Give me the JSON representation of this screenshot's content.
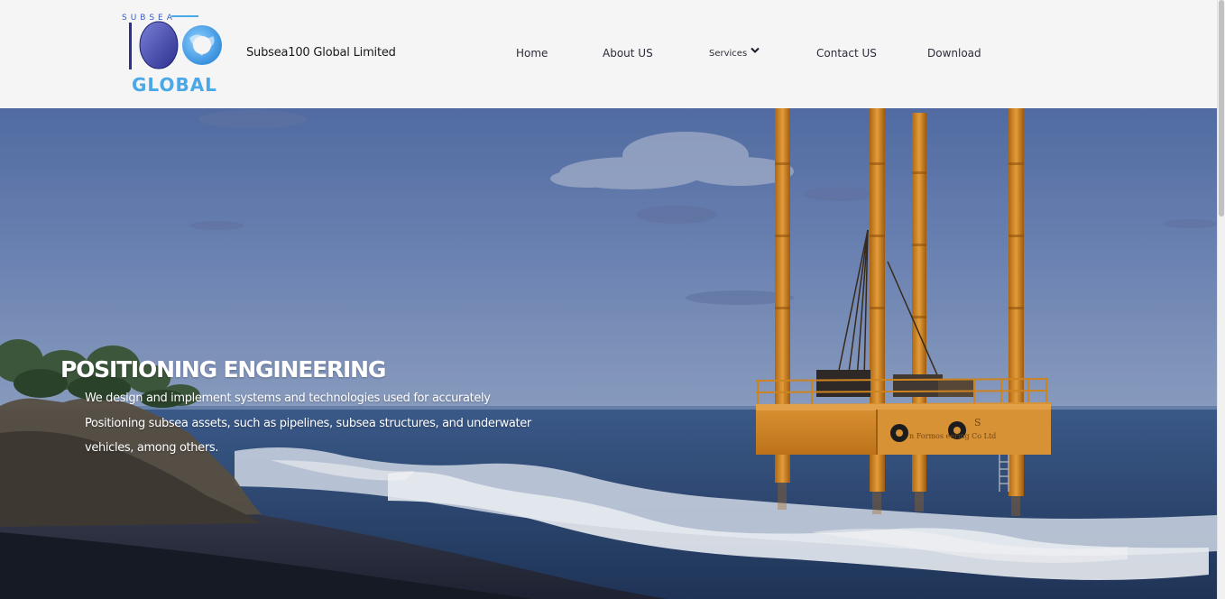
{
  "logo": {
    "top_text": "SUBSEA",
    "number_text": "10",
    "bottom_text": "GLOBAL"
  },
  "brand": {
    "name": "Subsea100 Global Limited"
  },
  "nav": {
    "home": "Home",
    "about": "About US",
    "services": "Services",
    "contact": "Contact US",
    "download": "Download"
  },
  "hero": {
    "title": "POSITIONING ENGINEERING",
    "description": "We design and implement systems and technologies used for accurately Positioning subsea assets, such as pipelines, subsea structures, and underwater vehicles, among others.",
    "rig_label": "S",
    "rig_panel_text": "n Formos   eering Co Ltd"
  },
  "icons": {
    "services_dropdown": "chevron-down-icon"
  },
  "colors": {
    "header_bg": "#f5f5f5",
    "logo_blue": "#3a5bc7",
    "logo_light_blue": "#4aa8e8",
    "sky_top": "#5b77ad",
    "sea": "#2c4a78",
    "rig_orange": "#d98a1f",
    "text_white": "#ffffff"
  }
}
